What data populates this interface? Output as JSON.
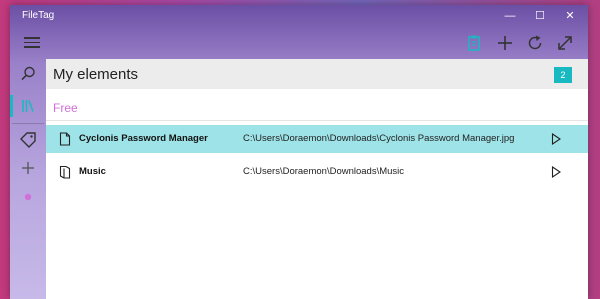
{
  "window": {
    "title": "FileTag",
    "controls": {
      "minimize": "—",
      "maximize": "☐",
      "close": "✕"
    }
  },
  "toolbar": {
    "icons": [
      "menu-icon",
      "clipboard-icon",
      "add-icon",
      "refresh-icon",
      "expand-icon"
    ]
  },
  "sidebar": {
    "icons": [
      "search-icon",
      "library-icon",
      "tag-icon",
      "add-icon",
      "dot-icon"
    ],
    "active_color": "#19b9c2",
    "dot_color": "#d070d8"
  },
  "main": {
    "title": "My elements",
    "count": "2",
    "group_label": "Free",
    "items": [
      {
        "name": "Cyclonis Password Manager",
        "path": "C:\\Users\\Doraemon\\Downloads\\Cyclonis Password Manager.jpg",
        "type": "file",
        "selected": true
      },
      {
        "name": "Music",
        "path": "C:\\Users\\Doraemon\\Downloads\\Music",
        "type": "folder",
        "selected": false
      }
    ]
  }
}
